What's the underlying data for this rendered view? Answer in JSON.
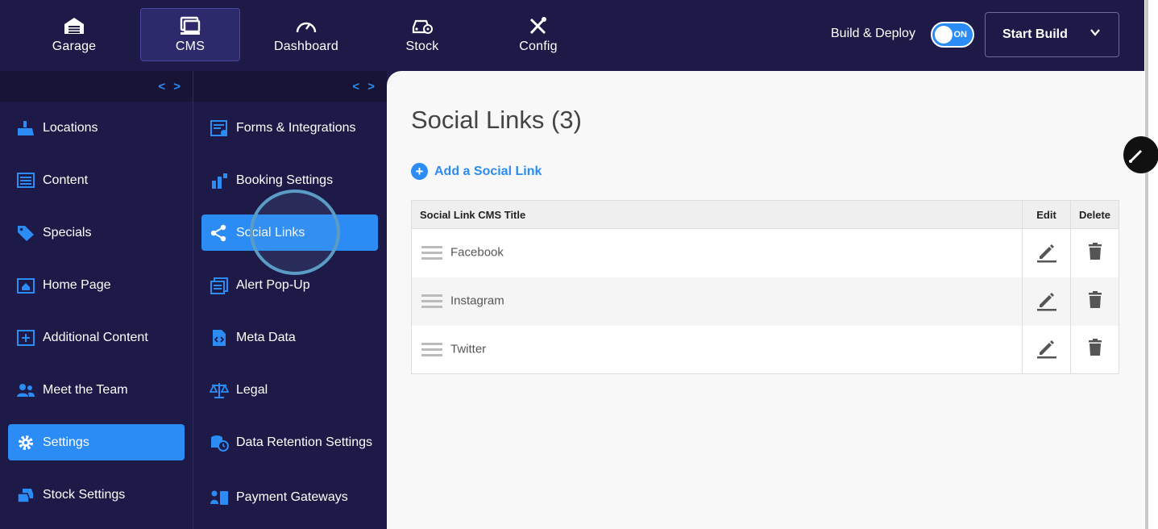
{
  "topnav": {
    "items": [
      {
        "label": "Garage",
        "icon": "garage-icon"
      },
      {
        "label": "CMS",
        "icon": "cms-icon"
      },
      {
        "label": "Dashboard",
        "icon": "gauge-icon"
      },
      {
        "label": "Stock",
        "icon": "car-gear-icon"
      },
      {
        "label": "Config",
        "icon": "tools-icon"
      }
    ],
    "active": "CMS",
    "build_label": "Build & Deploy",
    "toggle_state": "ON",
    "start_build_label": "Start Build"
  },
  "sidebar": {
    "collapse_glyph": "< >",
    "items": [
      {
        "label": "Locations",
        "icon": "location-icon"
      },
      {
        "label": "Content",
        "icon": "content-icon"
      },
      {
        "label": "Specials",
        "icon": "tag-icon"
      },
      {
        "label": "Home Page",
        "icon": "home-icon"
      },
      {
        "label": "Additional Content",
        "icon": "add-content-icon"
      },
      {
        "label": "Meet the Team",
        "icon": "team-icon"
      },
      {
        "label": "Settings",
        "icon": "gear-icon"
      },
      {
        "label": "Stock Settings",
        "icon": "stock-icon"
      }
    ],
    "active": "Settings"
  },
  "subsidebar": {
    "collapse_glyph": "< >",
    "items": [
      {
        "label": "Forms & Integrations",
        "icon": "form-icon"
      },
      {
        "label": "Booking Settings",
        "icon": "wrench-icon"
      },
      {
        "label": "Social Links",
        "icon": "share-icon"
      },
      {
        "label": "Alert Pop-Up",
        "icon": "alert-icon"
      },
      {
        "label": "Meta Data",
        "icon": "code-file-icon"
      },
      {
        "label": "Legal",
        "icon": "scales-icon"
      },
      {
        "label": "Data Retention Settings",
        "icon": "database-clock-icon"
      },
      {
        "label": "Payment Gateways",
        "icon": "payment-icon"
      }
    ],
    "active": "Social Links"
  },
  "main": {
    "title": "Social Links (3)",
    "add_label": "Add a Social Link",
    "table": {
      "columns": [
        "Social Link CMS Title",
        "Edit",
        "Delete"
      ],
      "rows": [
        "Facebook",
        "Instagram",
        "Twitter"
      ]
    }
  },
  "colors": {
    "nav_bg": "#1e1a47",
    "accent": "#2a8cf4",
    "main_bg": "#f8f8f8"
  }
}
